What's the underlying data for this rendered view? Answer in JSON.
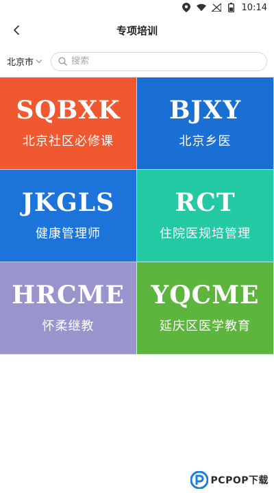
{
  "status": {
    "time": "10:14"
  },
  "nav": {
    "title": "专项培训"
  },
  "filter": {
    "city": "北京市",
    "search_placeholder": "搜索"
  },
  "tiles": [
    {
      "code": "SQBXK",
      "name": "北京社区必修课",
      "color": "#F0582F"
    },
    {
      "code": "BJXY",
      "name": "北京乡医",
      "color": "#1A6FD4"
    },
    {
      "code": "JKGLS",
      "name": "健康管理师",
      "color": "#1C73D9"
    },
    {
      "code": "RCT",
      "name": "住院医规培管理",
      "color": "#22C9A3"
    },
    {
      "code": "HRCME",
      "name": "怀柔继教",
      "color": "#9994CB"
    },
    {
      "code": "YQCME",
      "name": "延庆区医学教育",
      "color": "#5DB53D"
    }
  ],
  "watermark": {
    "text": "PCPOP下载"
  },
  "icons": {
    "back": "chevron-left-icon",
    "city": "chevron-down-icon",
    "search": "search-icon",
    "location": "location-icon",
    "wifi": "wifi-icon",
    "signal": "signal-icon",
    "battery": "battery-icon"
  }
}
